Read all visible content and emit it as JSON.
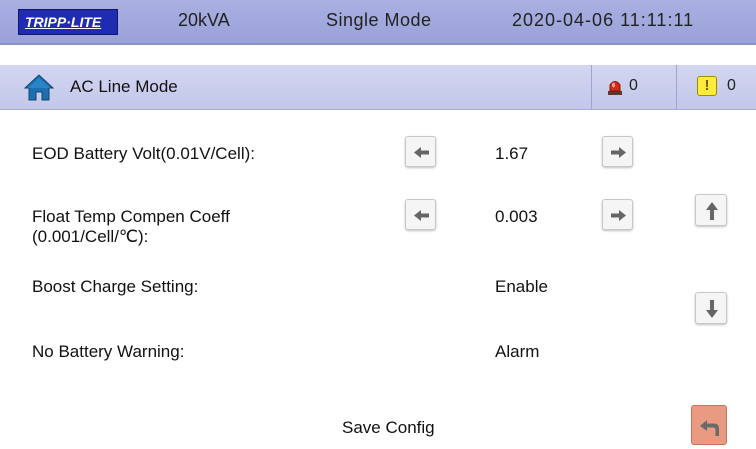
{
  "header": {
    "brand": "TRIPP·LITE",
    "capacity": "20kVA",
    "mode": "Single Mode",
    "datetime": "2020-04-06 11:11:11"
  },
  "status": {
    "label": "AC Line Mode",
    "alarm_count": "0",
    "warning_count": "0",
    "warning_glyph": "!"
  },
  "settings": {
    "eod_label": "EOD Battery Volt(0.01V/Cell):",
    "eod_value": "1.67",
    "float_label_line1": "Float Temp Compen Coeff",
    "float_label_line2": "(0.001/Cell/℃):",
    "float_value": "0.003",
    "boost_label": "Boost Charge Setting:",
    "boost_value": "Enable",
    "nobattery_label": "No Battery Warning:",
    "nobattery_value": "Alarm"
  },
  "footer": {
    "save_label": "Save Config"
  },
  "icons": {
    "home": "home-icon",
    "alarm": "alarm-light-icon",
    "warning": "warning-icon",
    "left": "arrow-left-icon",
    "right": "arrow-right-icon",
    "up": "arrow-up-icon",
    "down": "arrow-down-icon",
    "back": "back-arrow-icon"
  },
  "colors": {
    "header_bg": "#9aa1d8",
    "status_bg": "#c3c7ea",
    "logo_bg": "#1f2bb0",
    "warning_yellow": "#ffec3a",
    "back_button": "#e99b82"
  }
}
